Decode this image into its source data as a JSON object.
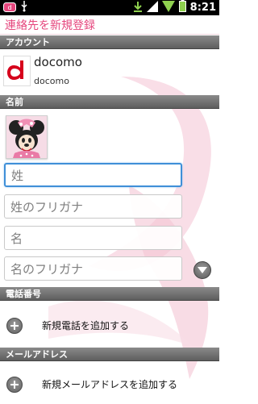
{
  "status_bar": {
    "time": "8:21",
    "icons": [
      "notification-icon",
      "usb-icon",
      "download-icon",
      "signal-icon",
      "wifi-icon",
      "battery-icon"
    ]
  },
  "header": {
    "title": "連絡先を新規登録"
  },
  "account_section": {
    "header": "アカウント",
    "account_name": "docomo",
    "account_type": "docomo",
    "logo_letter": "d"
  },
  "name_section": {
    "header": "名前",
    "fields": [
      {
        "placeholder": "姓",
        "value": ""
      },
      {
        "placeholder": "姓のフリガナ",
        "value": ""
      },
      {
        "placeholder": "名",
        "value": ""
      },
      {
        "placeholder": "名のフリガナ",
        "value": ""
      }
    ]
  },
  "phone_section": {
    "header": "電話番号",
    "add_label": "新規電話を追加する"
  },
  "email_section": {
    "header": "メールアドレス",
    "add_label": "新規メールアドレスを追加する"
  },
  "colors": {
    "accent": "#e5467d",
    "focus": "#3f8fd8",
    "logo_red": "#d6001c"
  }
}
